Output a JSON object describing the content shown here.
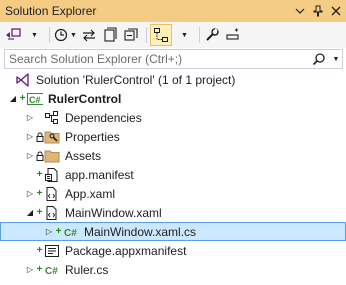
{
  "window": {
    "title": "Solution Explorer"
  },
  "search": {
    "placeholder": "Search Solution Explorer (Ctrl+;)"
  },
  "tree": {
    "solution": "Solution 'RulerControl' (1 of 1 project)",
    "project": "RulerControl",
    "dependencies": "Dependencies",
    "properties": "Properties",
    "assets": "Assets",
    "app_manifest": "app.manifest",
    "app_xaml": "App.xaml",
    "mainwindow_xaml": "MainWindow.xaml",
    "mainwindow_xaml_cs": "MainWindow.xaml.cs",
    "package_manifest": "Package.appxmanifest",
    "ruler_cs": "Ruler.cs"
  },
  "colors": {
    "title_bar": "#f5cc84",
    "selection": "#cce8ff",
    "csharp": "#388a34",
    "solution_purple": "#68217a"
  }
}
